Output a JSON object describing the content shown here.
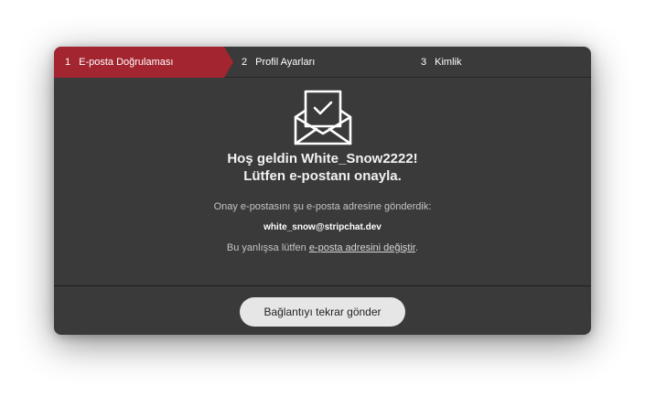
{
  "steps": [
    {
      "number": "1",
      "label": "E-posta Doğrulaması",
      "active": true
    },
    {
      "number": "2",
      "label": "Profil Ayarları",
      "active": false
    },
    {
      "number": "3",
      "label": "Kimlik",
      "active": false
    }
  ],
  "icon": "envelope-check-icon",
  "title_line1": "Hoş geldin White_Snow2222!",
  "title_line2": "Lütfen e-postanı onayla.",
  "sent_text": "Onay e-postasını şu e-posta adresine gönderdik:",
  "email": "white_snow@stripchat.dev",
  "mistake_prefix": "Bu yanlışsa lütfen ",
  "change_link": "e-posta adresini değiştir",
  "mistake_suffix": ".",
  "resend_button": "Bağlantıyı tekrar gönder",
  "colors": {
    "active_step": "#a32530",
    "modal_bg": "#3a3a3a",
    "button_bg": "#e6e6e6"
  }
}
